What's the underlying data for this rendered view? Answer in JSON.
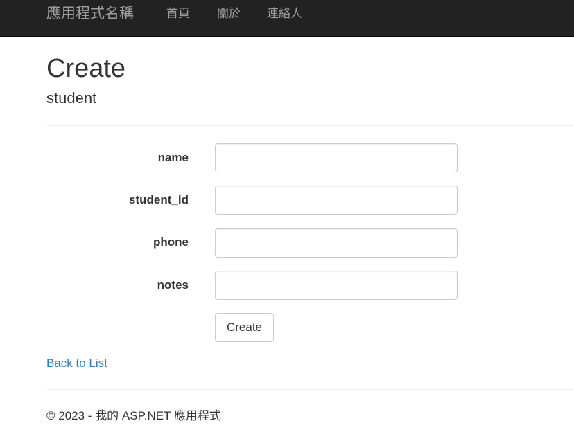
{
  "navbar": {
    "brand": "應用程式名稱",
    "links": [
      {
        "label": "首頁"
      },
      {
        "label": "關於"
      },
      {
        "label": "連絡人"
      }
    ],
    "background": "#222222",
    "link_color": "#9d9d9d"
  },
  "page": {
    "title": "Create",
    "subtitle": "student"
  },
  "form": {
    "fields": [
      {
        "label": "name",
        "value": "",
        "placeholder": ""
      },
      {
        "label": "student_id",
        "value": "",
        "placeholder": ""
      },
      {
        "label": "phone",
        "value": "",
        "placeholder": ""
      },
      {
        "label": "notes",
        "value": "",
        "placeholder": ""
      }
    ],
    "submit_label": "Create"
  },
  "back_link": {
    "label": "Back to List",
    "color": "#337ab7"
  },
  "footer": {
    "text": "© 2023 - 我的 ASP.NET 應用程式"
  }
}
